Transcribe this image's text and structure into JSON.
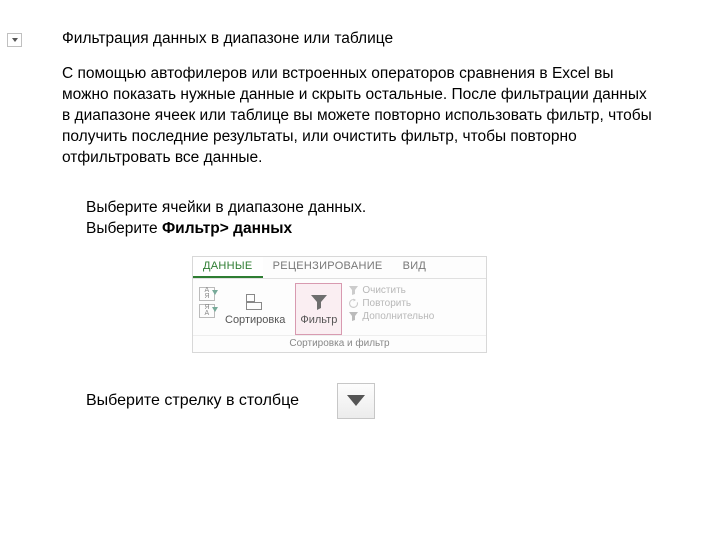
{
  "heading": "Фильтрация данных в диапазоне или таблице",
  "paragraph": "С помощью автофилеров или встроенных операторов сравнения в Excel вы можно показать нужные данные и скрыть остальные. После фильтрации данных в диапазоне ячеек или таблице вы можете повторно использовать фильтр, чтобы получить последние результаты, или очистить фильтр, чтобы повторно отфильтровать все данные.",
  "step1": "Выберите ячейки в диапазоне данных.",
  "step2_prefix": "Выберите ",
  "step2_bold": "Фильтр> данных",
  "ribbon": {
    "tabs": {
      "data": "ДАННЫЕ",
      "review": "РЕЦЕНЗИРОВАНИЕ",
      "view": "ВИД"
    },
    "sort_label": "Сортировка",
    "filter_label": "Фильтр",
    "clear": "Очистить",
    "reapply": "Повторить",
    "advanced": "Дополнительно",
    "group_caption": "Сортировка и фильтр"
  },
  "step3": "Выберите стрелку в столбце"
}
